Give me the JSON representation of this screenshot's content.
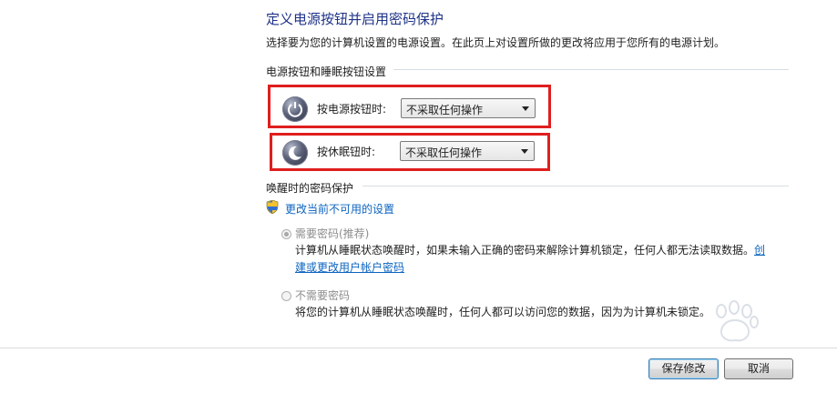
{
  "header": {
    "title": "定义电源按钮并启用密码保护",
    "description": "选择要为您的计算机设置的电源设置。在此页上对设置所做的更改将应用于您所有的电源计划。"
  },
  "power_section": {
    "heading": "电源按钮和睡眠按钮设置",
    "power_button": {
      "label": "按电源按钮时:",
      "value": "不采取任何操作"
    },
    "sleep_button": {
      "label": "按休眠钮时:",
      "value": "不采取任何操作"
    }
  },
  "wake_section": {
    "heading": "唤醒时的密码保护",
    "change_link": "更改当前不可用的设置",
    "option_require": {
      "label": "需要密码(推荐)",
      "desc_line1": "计算机从睡眠状态唤醒时，如果未输入正确的密码来解除计算机锁定，任何人都无法读取数据。",
      "link_part1": "创",
      "link_part2": "建或更改用户帐户密码"
    },
    "option_none": {
      "label": "不需要密码",
      "desc": "将您的计算机从睡眠状态唤醒时，任何人都可以访问您的数据，因为为计算机未锁定。"
    }
  },
  "footer": {
    "save_label": "保存修改",
    "cancel_label": "取消"
  },
  "colors": {
    "title": "#1e3287",
    "link": "#0c64c0",
    "highlight_box": "#e01e1e"
  },
  "icons": [
    "power-icon",
    "sleep-icon",
    "shield-icon"
  ]
}
